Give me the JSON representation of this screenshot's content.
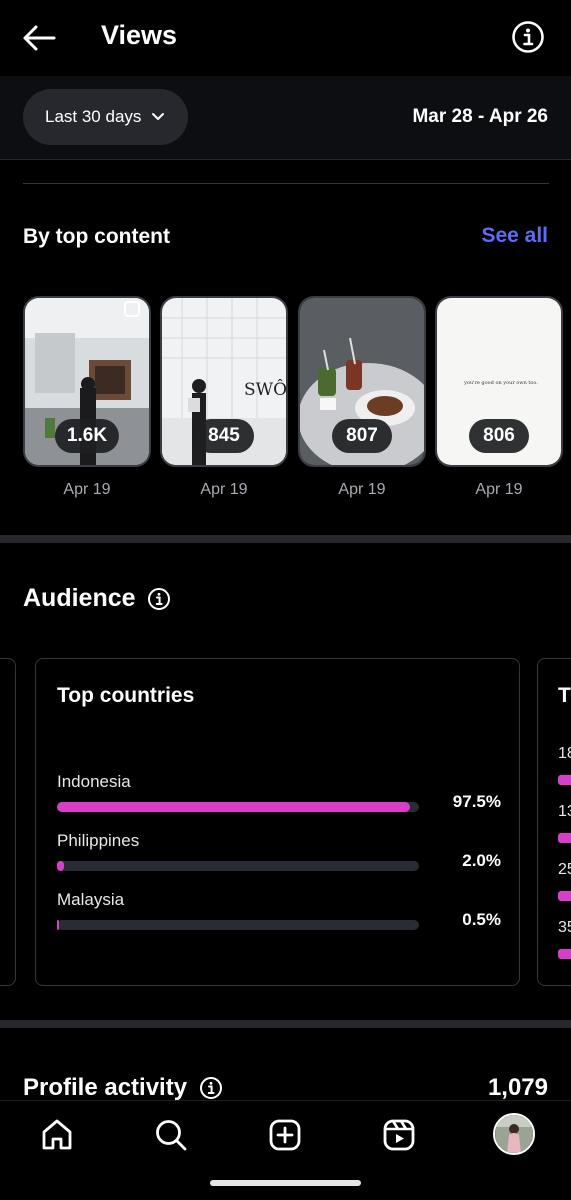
{
  "header": {
    "title": "Views",
    "back_icon": "arrow-left-icon",
    "info_icon": "info-icon"
  },
  "filter": {
    "range_label": "Last 30 days",
    "date_range": "Mar 28 - Apr 26"
  },
  "top_content": {
    "title": "By top content",
    "see_all": "See all",
    "items": [
      {
        "count": "1.6K",
        "date": "Apr 19"
      },
      {
        "count": "845",
        "date": "Apr 19",
        "overlay_text": "SWÔL"
      },
      {
        "count": "807",
        "date": "Apr 19"
      },
      {
        "count": "806",
        "date": "Apr 19",
        "overlay_text": "you're good on your own too."
      }
    ]
  },
  "audience": {
    "title": "Audience",
    "top_countries": {
      "title": "Top countries",
      "accent_color": "#d640c9",
      "rows": [
        {
          "name": "Indonesia",
          "percent": "97.5%",
          "value": 97.5
        },
        {
          "name": "Philippines",
          "percent": "2.0%",
          "value": 2.0
        },
        {
          "name": "Malaysia",
          "percent": "0.5%",
          "value": 0.5
        }
      ]
    },
    "next_card": {
      "title": "T",
      "rows": [
        "18",
        "13",
        "25",
        "35"
      ]
    }
  },
  "profile_activity": {
    "title": "Profile activity",
    "value": "1,079"
  },
  "nav": [
    "home-icon",
    "search-icon",
    "create-icon",
    "reels-icon",
    "profile-avatar"
  ]
}
